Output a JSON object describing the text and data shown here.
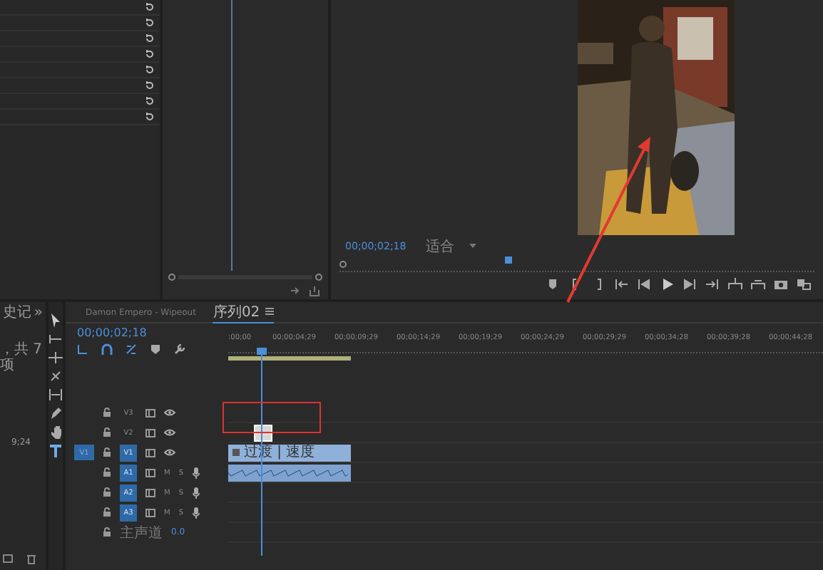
{
  "project_panel": {
    "tab": "史记",
    "more": "»",
    "count": "，共 7 项",
    "duration": "9;24"
  },
  "program_monitor": {
    "timecode": "00;00;02;18",
    "fit": "适合"
  },
  "timeline": {
    "tabs": [
      {
        "label": "Damon Empero - Wipeout",
        "selected": false
      },
      {
        "label": "序列02",
        "selected": true
      }
    ],
    "timecode": "00;00;02;18",
    "ruler": [
      ":00;00",
      "00;00;04;29",
      "00;00;09;29",
      "00;00;14;29",
      "00;00;19;29",
      "00;00;24;29",
      "00;00;29;29",
      "00;00;34;28",
      "00;00;39;28",
      "00;00;44;28"
    ],
    "tracks": [
      {
        "kind": "video",
        "name": "V3",
        "targeted": false
      },
      {
        "kind": "video",
        "name": "V2",
        "targeted": false,
        "clip": {
          "kind": "title"
        }
      },
      {
        "kind": "video",
        "name": "V1",
        "targeted": true,
        "source_patch": "V1",
        "clip": {
          "kind": "video",
          "label": "过渡 | 速度"
        }
      },
      {
        "kind": "audio",
        "name": "A1",
        "targeted": true,
        "mute": "M",
        "solo": "S",
        "clip": {
          "kind": "audio"
        }
      },
      {
        "kind": "audio",
        "name": "A2",
        "targeted": true,
        "mute": "M",
        "solo": "S"
      },
      {
        "kind": "audio",
        "name": "A3",
        "targeted": true,
        "mute": "M",
        "solo": "S"
      },
      {
        "kind": "master",
        "name": "主声道",
        "value": "0.0"
      }
    ]
  }
}
